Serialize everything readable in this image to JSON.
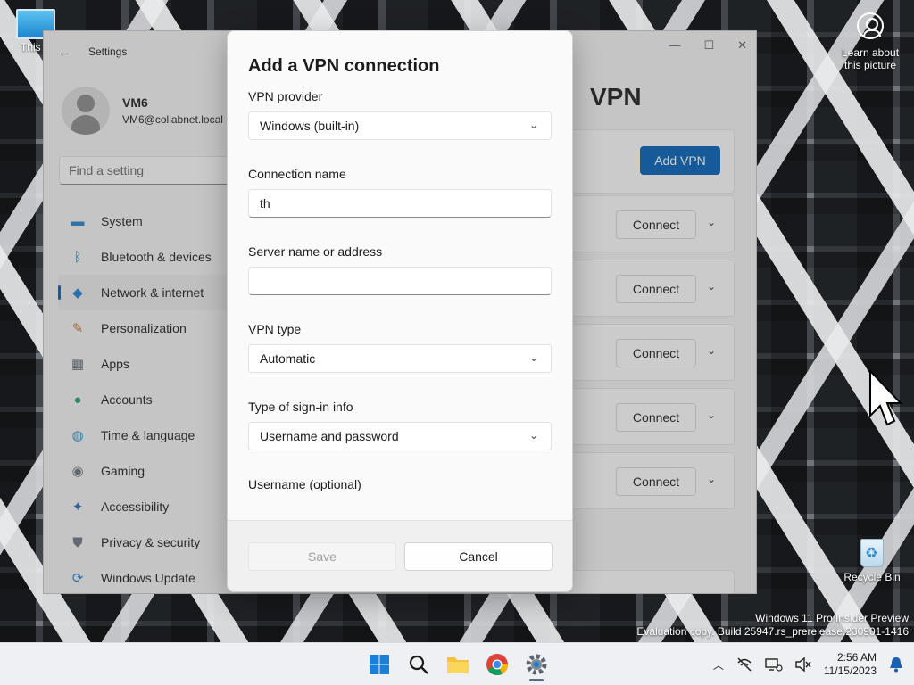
{
  "desktop": {
    "this_pc_label": "This P",
    "learn_label": "Learn about this picture",
    "recycle_label": "Recycle Bin",
    "watermark_line1": "Windows 11 Pro Insider Preview",
    "watermark_line2": "Evaluation copy. Build 25947.rs_prerelease.230901-1416"
  },
  "settings": {
    "title": "Settings",
    "user": {
      "name": "VM6",
      "email": "VM6@collabnet.local"
    },
    "search_placeholder": "Find a setting",
    "nav": [
      {
        "label": "System",
        "icon": "monitor-icon",
        "active": false
      },
      {
        "label": "Bluetooth & devices",
        "icon": "bluetooth-icon",
        "active": false
      },
      {
        "label": "Network & internet",
        "icon": "wifi-icon",
        "active": true
      },
      {
        "label": "Personalization",
        "icon": "brush-icon",
        "active": false
      },
      {
        "label": "Apps",
        "icon": "apps-icon",
        "active": false
      },
      {
        "label": "Accounts",
        "icon": "person-icon",
        "active": false
      },
      {
        "label": "Time & language",
        "icon": "globe-icon",
        "active": false
      },
      {
        "label": "Gaming",
        "icon": "gamepad-icon",
        "active": false
      },
      {
        "label": "Accessibility",
        "icon": "accessibility-icon",
        "active": false
      },
      {
        "label": "Privacy & security",
        "icon": "shield-icon",
        "active": false
      },
      {
        "label": "Windows Update",
        "icon": "update-icon",
        "active": false
      }
    ],
    "page_heading": "VPN",
    "add_vpn_label": "Add VPN",
    "connect_label": "Connect",
    "connection_rows": 5
  },
  "dialog": {
    "title": "Add a VPN connection",
    "vpn_provider": {
      "label": "VPN provider",
      "value": "Windows (built-in)"
    },
    "connection_name": {
      "label": "Connection name",
      "value": "th"
    },
    "server": {
      "label": "Server name or address",
      "value": ""
    },
    "vpn_type": {
      "label": "VPN type",
      "value": "Automatic"
    },
    "signin_type": {
      "label": "Type of sign-in info",
      "value": "Username and password"
    },
    "username": {
      "label": "Username (optional)"
    },
    "save_label": "Save",
    "cancel_label": "Cancel"
  },
  "taskbar": {
    "time": "2:56 AM",
    "date": "11/15/2023"
  },
  "colors": {
    "accent": "#005fb8"
  }
}
